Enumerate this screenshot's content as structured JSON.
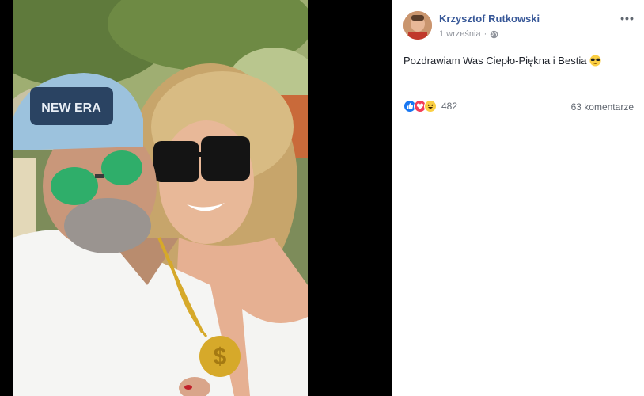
{
  "post": {
    "author": "Krzysztof Rutkowski",
    "date": "1 września",
    "separator": "·",
    "privacy_icon": "globe-icon",
    "menu_label": "•••",
    "text": "Pozdrawiam Was Ciepło-Piękna i Bestia",
    "text_emoji": "sunglasses-emoji"
  },
  "photo": {
    "cap_text": "NEW ERA"
  },
  "engagement": {
    "reaction_icons": [
      "like-icon",
      "love-icon",
      "haha-icon"
    ],
    "reaction_count": "482",
    "comments": "63 komentarze"
  },
  "colors": {
    "author_link": "#385898",
    "meta_gray": "#90949c",
    "like_blue": "#1877f2",
    "love_red": "#f33e58",
    "haha_yellow": "#fbcf43"
  }
}
